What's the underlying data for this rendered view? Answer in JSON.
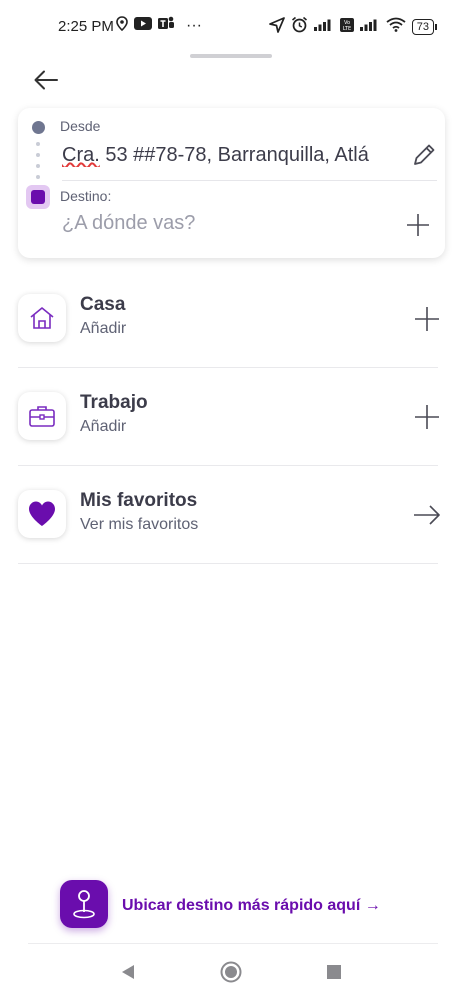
{
  "status_bar": {
    "time": "2:25 PM",
    "dots": "···",
    "battery": "73",
    "left_icons": [
      "location-pin-icon",
      "youtube-icon",
      "teams-icon"
    ],
    "right_icons": [
      "navigation-arrow-icon",
      "alarm-icon",
      "signal-icon",
      "volte-icon",
      "signal-icon",
      "wifi-icon",
      "battery-icon"
    ]
  },
  "route": {
    "origin_label": "Desde",
    "origin_value_abbrev": "Cra.",
    "origin_value_rest": " 53 ##78-78, Barranquilla, Atlá",
    "destination_label": "Destino:",
    "destination_placeholder": "¿A dónde vas?"
  },
  "saved_places": [
    {
      "title": "Casa",
      "subtitle": "Añadir",
      "icon": "home-icon",
      "action": "plus-icon"
    },
    {
      "title": "Trabajo",
      "subtitle": "Añadir",
      "icon": "briefcase-icon",
      "action": "plus-icon"
    },
    {
      "title": "Mis favoritos",
      "subtitle": "Ver mis favoritos",
      "icon": "heart-icon",
      "action": "arrow-right-icon"
    }
  ],
  "promo": {
    "text": "Ubicar destino más rápido aquí →",
    "icon": "map-pin-icon"
  },
  "colors": {
    "accent": "#6a0dad",
    "text": "#3c3c4a",
    "muted": "#5f6274"
  }
}
